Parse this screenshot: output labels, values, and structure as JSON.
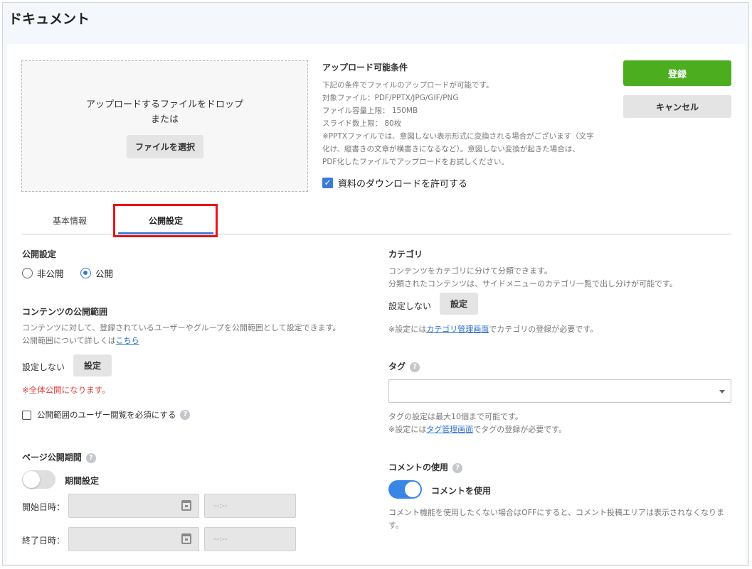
{
  "page": {
    "title": "ドキュメント"
  },
  "upload": {
    "drop_text": "アップロードするファイルをドロップ",
    "or_text": "または",
    "select_button": "ファイルを選択"
  },
  "conditions": {
    "title": "アップロード可能条件",
    "lines": [
      "下記の条件でファイルのアップロードが可能です。",
      "対象ファイル：PDF/PPTX/JPG/GIF/PNG",
      "ファイル容量上限： 150MB",
      "スライド数上限： 80枚",
      "※PPTXファイルでは、意図しない表示形式に変換される場合がございます（文字",
      "化け、縦書きの文章が横書きになるなど）。意図しない変換が起きた場合は、",
      "PDF化したファイルでアップロードをお試しください。"
    ],
    "download_checkbox_label": "資料のダウンロードを許可する"
  },
  "actions": {
    "register": "登録",
    "cancel": "キャンセル"
  },
  "tabs": [
    {
      "label": "基本情報"
    },
    {
      "label": "公開設定"
    }
  ],
  "publish": {
    "label": "公開設定",
    "options": [
      "非公開",
      "公開"
    ],
    "selected": "公開"
  },
  "scope": {
    "title": "コンテンツの公開範囲",
    "desc": "コンテンツに対して、登録されているユーザーやグループを公開範囲として設定できます。",
    "detail_prefix": "公開範囲について詳しくは",
    "detail_link": "こちら",
    "current": "設定しない",
    "set_button": "設定",
    "warning": "※全体公開になります。",
    "required_checkbox": "公開範囲のユーザー閲覧を必須にする"
  },
  "period": {
    "title": "ページ公開期間",
    "toggle_label": "期間設定",
    "start_label": "開始日時：",
    "end_label": "終了日時：",
    "time_placeholder": "--:--"
  },
  "category": {
    "title": "カテゴリ",
    "desc1": "コンテンツをカテゴリに分けて分類できます。",
    "desc2": "分類されたコンテンツは、サイドメニューのカテゴリ一覧で出し分けが可能です。",
    "current": "設定しない",
    "set_button": "設定",
    "note_prefix": "※設定には",
    "note_link": "カテゴリ管理画面",
    "note_suffix": "でカテゴリの登録が必要です。"
  },
  "tag": {
    "title": "タグ",
    "limit_note": "タグの設定は最大10個まで可能です。",
    "note_prefix": "※設定には",
    "note_link": "タグ管理画面",
    "note_suffix": "でタグの登録が必要です。"
  },
  "comment": {
    "title": "コメントの使用",
    "toggle_label": "コメントを使用",
    "desc_line1": "コメント機能を使用したくない場合はOFFにすると、コメント投稿エリアは表示されなくなりま",
    "desc_line2": "す。"
  },
  "icons": {
    "help": "?",
    "check": "✓"
  },
  "colors": {
    "accent": "#3a7bd5",
    "register_green": "#4cae1e",
    "warning_red": "#e03b3b",
    "highlight_red": "#e8141b"
  }
}
